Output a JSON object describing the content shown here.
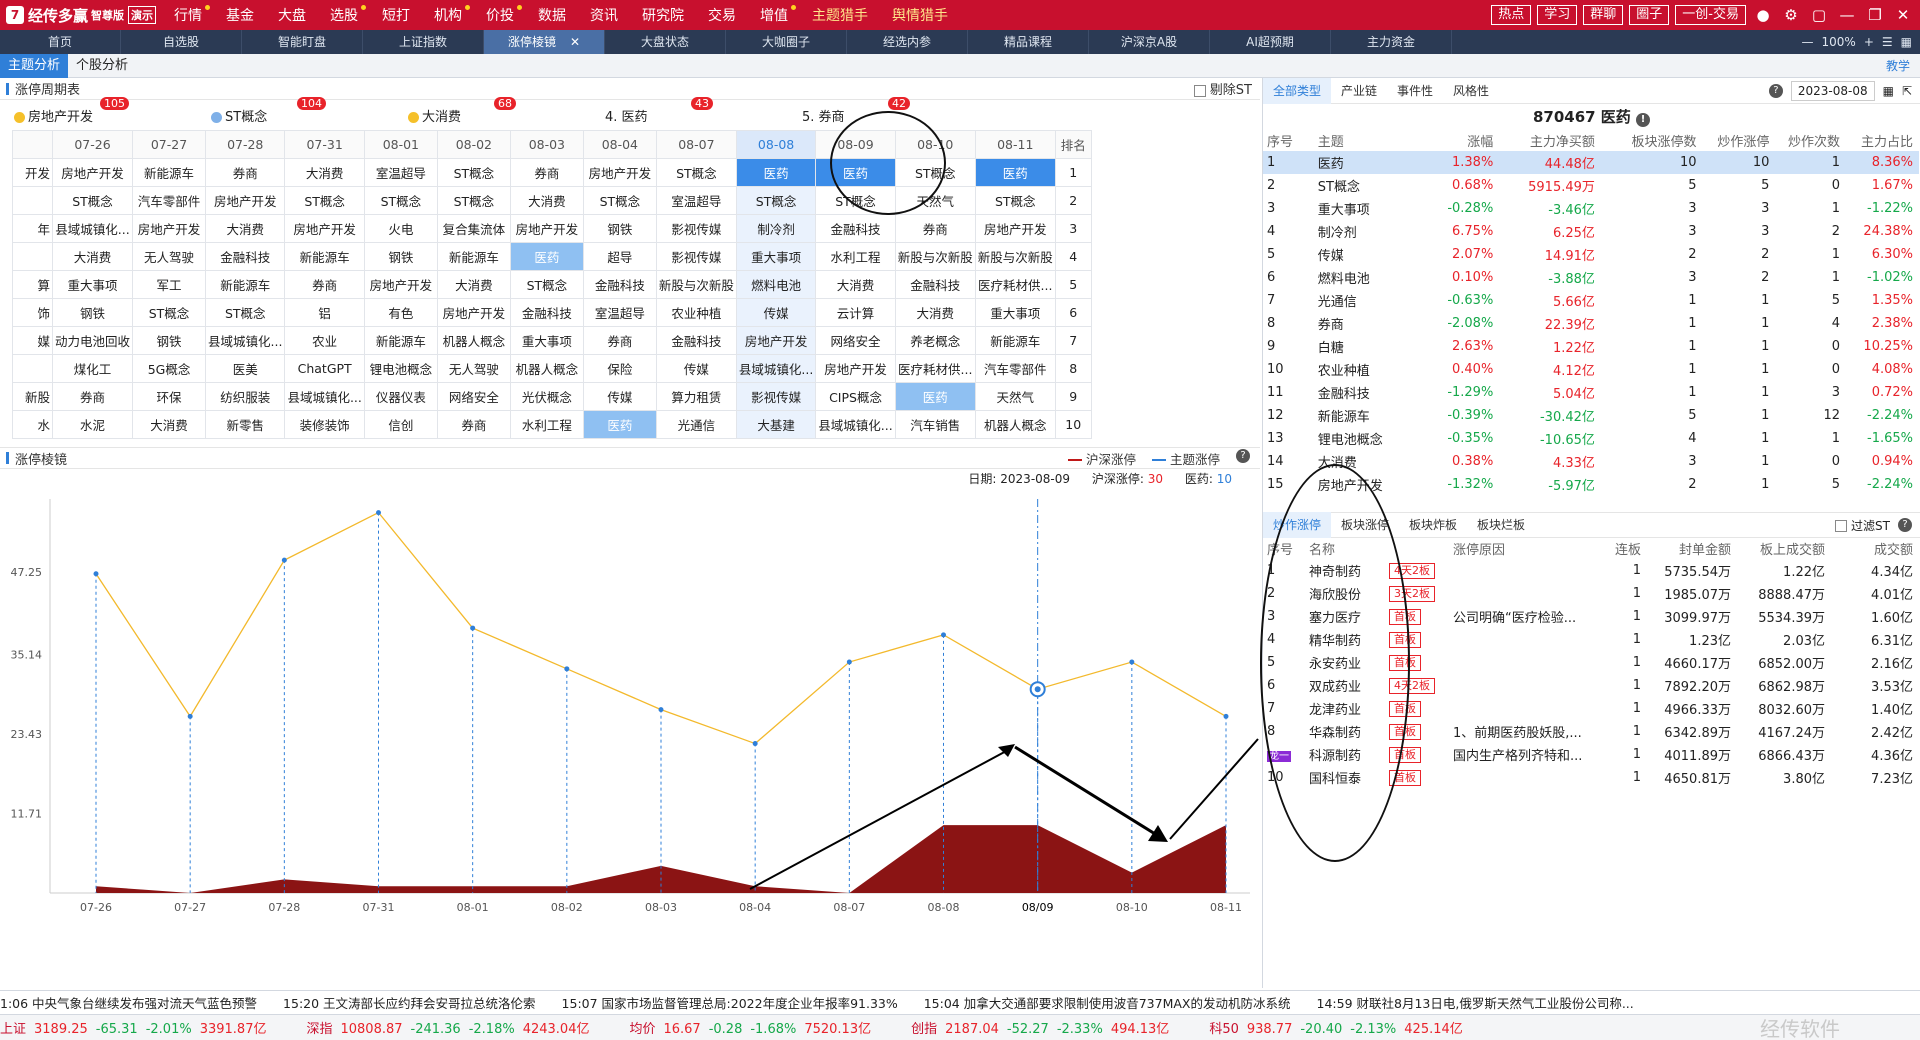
{
  "app": {
    "logo": "经传多赢",
    "edition": "智尊版",
    "demo": "演示",
    "menu": [
      "行情",
      "基金",
      "大盘",
      "选股",
      "短打",
      "机构",
      "价投",
      "数据",
      "资讯",
      "研究院",
      "交易",
      "增值",
      "主题猎手",
      "舆情猎手"
    ],
    "right_buttons": [
      "热点",
      "学习",
      "群聊",
      "圈子",
      "一创-交易"
    ]
  },
  "tabs": [
    "首页",
    "自选股",
    "智能盯盘",
    "上证指数",
    "涨停棱镜",
    "大盘状态",
    "大咖圈子",
    "经选内参",
    "精品课程",
    "沪深京A股",
    "AI超预期",
    "主力资金"
  ],
  "zoom": "100%",
  "sub_tabs": [
    "主题分析",
    "个股分析"
  ],
  "teach": "教学",
  "cycle": {
    "title": "涨停周期表",
    "exclude_st": "剔除ST",
    "legend": [
      {
        "name": "房地产开发",
        "count": "105",
        "color": "#f5c02a"
      },
      {
        "name": "ST概念",
        "count": "104",
        "color": "#7fb0e8"
      },
      {
        "name": "大消费",
        "count": "68",
        "color": "#f5c02a"
      },
      {
        "name": "4. 医药",
        "count": "43",
        "color": ""
      },
      {
        "name": "5. 券商",
        "count": "42",
        "color": ""
      }
    ],
    "dates": [
      "07-26",
      "07-27",
      "07-28",
      "07-31",
      "08-01",
      "08-02",
      "08-03",
      "08-04",
      "08-07",
      "08-08",
      "08-09",
      "08-10",
      "08-11"
    ],
    "rank_header": "排名",
    "cut": [
      "开发",
      "",
      "年",
      "",
      "算",
      "饰",
      "媒",
      "",
      "新股",
      "水"
    ],
    "rows": [
      [
        "房地产开发",
        "新能源车",
        "券商",
        "大消费",
        "室温超导",
        "ST概念",
        "券商",
        "房地产开发",
        "ST概念",
        "医药",
        "医药",
        "ST概念",
        "医药"
      ],
      [
        "ST概念",
        "汽车零部件",
        "房地产开发",
        "ST概念",
        "ST概念",
        "ST概念",
        "大消费",
        "ST概念",
        "室温超导",
        "ST概念",
        "ST概念",
        "天然气",
        "ST概念"
      ],
      [
        "县域城镇化...",
        "房地产开发",
        "大消费",
        "房地产开发",
        "火电",
        "复合集流体",
        "房地产开发",
        "钢铁",
        "影视传媒",
        "制冷剂",
        "金融科技",
        "券商",
        "房地产开发"
      ],
      [
        "大消费",
        "无人驾驶",
        "金融科技",
        "新能源车",
        "钢铁",
        "新能源车",
        "医药",
        "超导",
        "影视传媒",
        "重大事项",
        "水利工程",
        "新股与次新股",
        "新股与次新股"
      ],
      [
        "重大事项",
        "军工",
        "新能源车",
        "券商",
        "房地产开发",
        "大消费",
        "ST概念",
        "金融科技",
        "新股与次新股",
        "燃料电池",
        "大消费",
        "金融科技",
        "医疗耗材供..."
      ],
      [
        "钢铁",
        "ST概念",
        "ST概念",
        "铝",
        "有色",
        "房地产开发",
        "金融科技",
        "室温超导",
        "农业种植",
        "传媒",
        "云计算",
        "大消费",
        "重大事项"
      ],
      [
        "动力电池回收",
        "钢铁",
        "县域城镇化...",
        "农业",
        "新能源车",
        "机器人概念",
        "重大事项",
        "券商",
        "金融科技",
        "房地产开发",
        "网络安全",
        "养老概念",
        "新能源车"
      ],
      [
        "煤化工",
        "5G概念",
        "医美",
        "ChatGPT",
        "锂电池概念",
        "无人驾驶",
        "机器人概念",
        "保险",
        "传媒",
        "县域城镇化...",
        "房地产开发",
        "医疗耗材供...",
        "汽车零部件"
      ],
      [
        "券商",
        "环保",
        "纺织服装",
        "县域城镇化...",
        "仪器仪表",
        "网络安全",
        "光伏概念",
        "传媒",
        "算力租赁",
        "影视传媒",
        "CIPS概念",
        "医药",
        "天然气"
      ],
      [
        "水泥",
        "大消费",
        "新零售",
        "装修装饰",
        "信创",
        "券商",
        "水利工程",
        "医药",
        "光通信",
        "大基建",
        "县域城镇化...",
        "汽车销售",
        "机器人概念"
      ]
    ]
  },
  "prism": {
    "title": "涨停棱镜",
    "legend_a": "沪深涨停",
    "legend_b": "主题涨停",
    "info": {
      "date_label": "日期:",
      "date": "2023-08-09",
      "a_label": "沪深涨停:",
      "a_value": "30",
      "b_label": "医药:",
      "b_value": "10"
    }
  },
  "chart_data": {
    "type": "line",
    "x": [
      "07-26",
      "07-27",
      "07-28",
      "07-31",
      "08-01",
      "08-02",
      "08-03",
      "08-04",
      "08-07",
      "08-08",
      "08-09",
      "08-10",
      "08-11"
    ],
    "highlight_x": "08/09",
    "y_ticks": [
      "47.25",
      "35.14",
      "23.43",
      "11.71"
    ],
    "ylim": [
      0,
      58
    ],
    "series": [
      {
        "name": "沪深涨停",
        "color": "#f3b92c",
        "values": [
          47,
          26,
          49,
          56,
          39,
          33,
          27,
          22,
          34,
          38,
          30,
          34,
          26
        ]
      },
      {
        "name": "主题涨停",
        "color": "#8b1414",
        "values": [
          1,
          0,
          2,
          1,
          1,
          1,
          4,
          1,
          0,
          10,
          10,
          3,
          10
        ]
      }
    ]
  },
  "right": {
    "tabs": [
      "全部类型",
      "产业链",
      "事件性",
      "风格性"
    ],
    "date": "2023-08-08",
    "title": "870467 医药",
    "headers": [
      "序号",
      "主题",
      "涨幅",
      "主力净买额",
      "板块涨停数",
      "炒作涨停",
      "炒作次数",
      "主力占比"
    ],
    "rows": [
      [
        "1",
        "医药",
        "1.38%",
        "44.48亿",
        "10",
        "10",
        "1",
        "8.36%"
      ],
      [
        "2",
        "ST概念",
        "0.68%",
        "5915.49万",
        "5",
        "5",
        "0",
        "1.67%"
      ],
      [
        "3",
        "重大事项",
        "-0.28%",
        "-3.46亿",
        "3",
        "3",
        "1",
        "-1.22%"
      ],
      [
        "4",
        "制冷剂",
        "6.75%",
        "6.25亿",
        "3",
        "3",
        "2",
        "24.38%"
      ],
      [
        "5",
        "传媒",
        "2.07%",
        "14.91亿",
        "2",
        "2",
        "1",
        "6.30%"
      ],
      [
        "6",
        "燃料电池",
        "0.10%",
        "-3.88亿",
        "3",
        "2",
        "1",
        "-1.02%"
      ],
      [
        "7",
        "光通信",
        "-0.63%",
        "5.66亿",
        "1",
        "1",
        "5",
        "1.35%"
      ],
      [
        "8",
        "券商",
        "-2.08%",
        "22.39亿",
        "1",
        "1",
        "4",
        "2.38%"
      ],
      [
        "9",
        "白糖",
        "2.63%",
        "1.22亿",
        "1",
        "1",
        "0",
        "10.25%"
      ],
      [
        "10",
        "农业种植",
        "0.40%",
        "4.12亿",
        "1",
        "1",
        "0",
        "4.08%"
      ],
      [
        "11",
        "金融科技",
        "-1.29%",
        "5.04亿",
        "1",
        "1",
        "3",
        "0.72%"
      ],
      [
        "12",
        "新能源车",
        "-0.39%",
        "-30.42亿",
        "5",
        "1",
        "12",
        "-2.24%"
      ],
      [
        "13",
        "锂电池概念",
        "-0.35%",
        "-10.65亿",
        "4",
        "1",
        "1",
        "-1.65%"
      ],
      [
        "14",
        "大消费",
        "0.38%",
        "4.33亿",
        "3",
        "1",
        "0",
        "0.94%"
      ],
      [
        "15",
        "房地产开发",
        "-1.32%",
        "-5.97亿",
        "2",
        "1",
        "5",
        "-2.24%"
      ]
    ],
    "stock_tabs": [
      "炒作涨停",
      "板块涨停",
      "板块炸板",
      "板块烂板"
    ],
    "filter_st": "过滤ST",
    "stock_headers": [
      "序号",
      "名称",
      "",
      "涨停原因",
      "连板",
      "封单金额",
      "板上成交额",
      "成交额"
    ],
    "stocks": [
      [
        "1",
        "神奇制药",
        "4天2板",
        "",
        "1",
        "5735.54万",
        "1.22亿",
        "4.34亿"
      ],
      [
        "2",
        "海欣股份",
        "3天2板",
        "",
        "1",
        "1985.07万",
        "8888.47万",
        "4.01亿"
      ],
      [
        "3",
        "塞力医疗",
        "首板",
        "公司明确“医疗检验...",
        "1",
        "3099.97万",
        "5534.39万",
        "1.60亿"
      ],
      [
        "4",
        "精华制药",
        "首板",
        "",
        "1",
        "1.23亿",
        "2.03亿",
        "6.31亿"
      ],
      [
        "5",
        "永安药业",
        "首板",
        "",
        "1",
        "4660.17万",
        "6852.00万",
        "2.16亿"
      ],
      [
        "6",
        "双成药业",
        "4天2板",
        "",
        "1",
        "7892.20万",
        "6862.98万",
        "3.53亿"
      ],
      [
        "7",
        "龙津药业",
        "首板",
        "",
        "1",
        "4966.33万",
        "8032.60万",
        "1.40亿"
      ],
      [
        "8",
        "华森制药",
        "首板",
        "1、前期医药股妖股,...",
        "1",
        "6342.89万",
        "4167.24万",
        "2.42亿"
      ],
      [
        "9",
        "科源制药",
        "首板",
        "国内生产格列齐特和...",
        "1",
        "4011.89万",
        "6866.43万",
        "4.36亿"
      ],
      [
        "10",
        "国科恒泰",
        "首板",
        "",
        "1",
        "4650.81万",
        "3.80亿",
        "7.23亿"
      ]
    ],
    "dragon": "龙一"
  },
  "ticker": [
    "1:06 中央气象台继续发布强对流天气蓝色预警",
    "15:20 王文涛部长应约拜会安哥拉总统洛伦索",
    "15:07 国家市场监督管理总局:2022年度企业年报率91.33%",
    "15:04 加拿大交通部要求限制使用波音737MAX的发动机防冰系统",
    "14:59 财联社8月13日电,俄罗斯天然气工业股份公司称..."
  ],
  "indexes": [
    {
      "name": "上证",
      "price": "3189.25",
      "chg": "-65.31",
      "pct": "-2.01%",
      "amt": "3391.87亿"
    },
    {
      "name": "深指",
      "price": "10808.87",
      "chg": "-241.36",
      "pct": "-2.18%",
      "amt": "4243.04亿"
    },
    {
      "name": "均价",
      "price": "16.67",
      "chg": "-0.28",
      "pct": "-1.68%",
      "amt": "7520.13亿"
    },
    {
      "name": "创指",
      "price": "2187.04",
      "chg": "-52.27",
      "pct": "-2.33%",
      "amt": "494.13亿"
    },
    {
      "name": "科50",
      "price": "938.77",
      "chg": "-20.40",
      "pct": "-2.13%",
      "amt": "425.14亿"
    }
  ],
  "watermark": "经传软件"
}
